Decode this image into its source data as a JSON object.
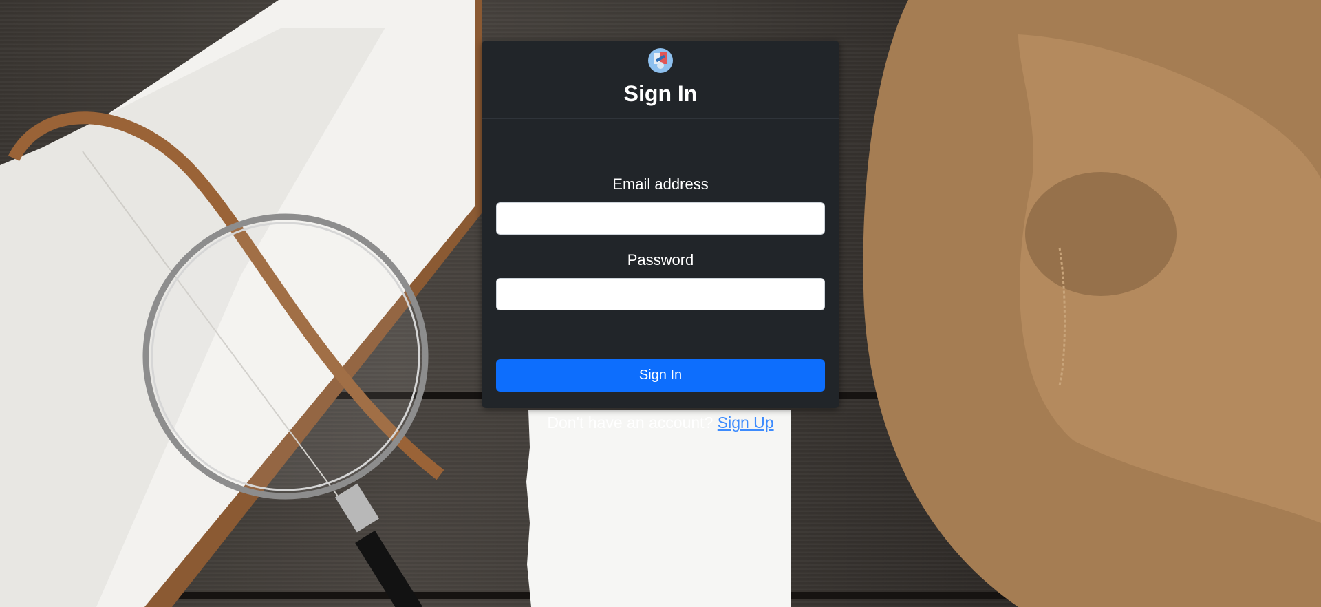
{
  "app": {
    "logo_icon": "app-logo-icon",
    "title": "Sign In"
  },
  "form": {
    "email_label": "Email address",
    "email_value": "",
    "email_placeholder": "",
    "password_label": "Password",
    "password_value": "",
    "password_placeholder": "",
    "submit_label": "Sign In"
  },
  "footer": {
    "prompt": "Don't have an account?",
    "signup_link": "Sign Up"
  },
  "colors": {
    "card_bg": "#212529",
    "primary": "#0d6efd",
    "link": "#3d8bfd"
  }
}
